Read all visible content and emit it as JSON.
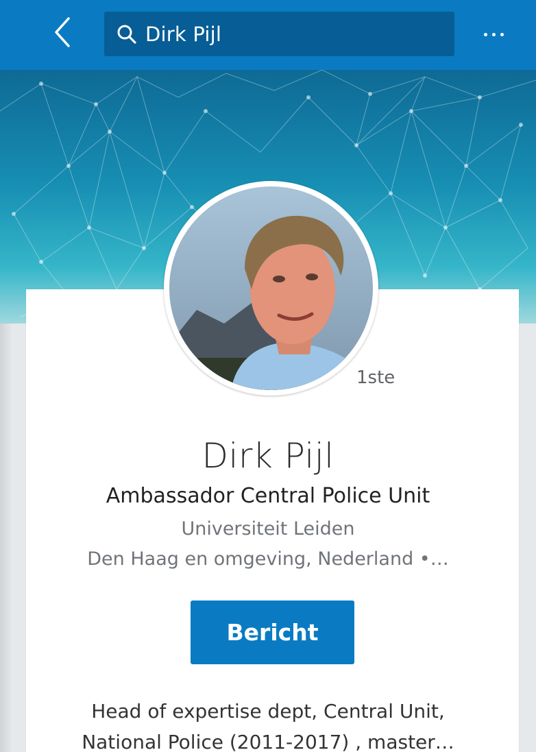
{
  "search": {
    "query": "Dirk Pijl"
  },
  "icons": {
    "back": "chevron-left-icon",
    "search": "search-icon",
    "more": "more-horizontal-icon"
  },
  "profile": {
    "connection_degree": "1ste",
    "name": "Dirk Pijl",
    "headline": "Ambassador Central Police Unit",
    "school": "Universiteit Leiden",
    "location": "Den Haag en omgeving, Nederland •…",
    "message_button": "Bericht",
    "summary_line1": "Head of expertise dept, Central Unit,",
    "summary_line2": "National Police (2011-2017) , master…"
  },
  "colors": {
    "appbar": "#0a7bc3",
    "search_box": "#075d96",
    "primary_button": "#0a7bc3",
    "banner_top": "#0e6a95",
    "banner_bottom": "#9fd8de"
  }
}
